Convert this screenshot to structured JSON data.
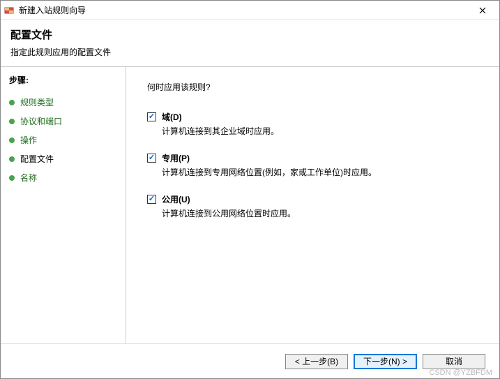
{
  "titlebar": {
    "title": "新建入站规则向导"
  },
  "header": {
    "title": "配置文件",
    "subtitle": "指定此规则应用的配置文件"
  },
  "sidebar": {
    "steps_label": "步骤:",
    "items": [
      {
        "label": "规则类型"
      },
      {
        "label": "协议和端口"
      },
      {
        "label": "操作"
      },
      {
        "label": "配置文件"
      },
      {
        "label": "名称"
      }
    ]
  },
  "content": {
    "question": "何时应用该规则?",
    "options": [
      {
        "label": "域(D)",
        "desc": "计算机连接到其企业域时应用。",
        "checked": true
      },
      {
        "label": "专用(P)",
        "desc": "计算机连接到专用网络位置(例如，家或工作单位)时应用。",
        "checked": true
      },
      {
        "label": "公用(U)",
        "desc": "计算机连接到公用网络位置时应用。",
        "checked": true
      }
    ]
  },
  "footer": {
    "back": "< 上一步(B)",
    "next": "下一步(N) >",
    "cancel": "取消"
  },
  "watermark": "CSDN @YZBFDM"
}
